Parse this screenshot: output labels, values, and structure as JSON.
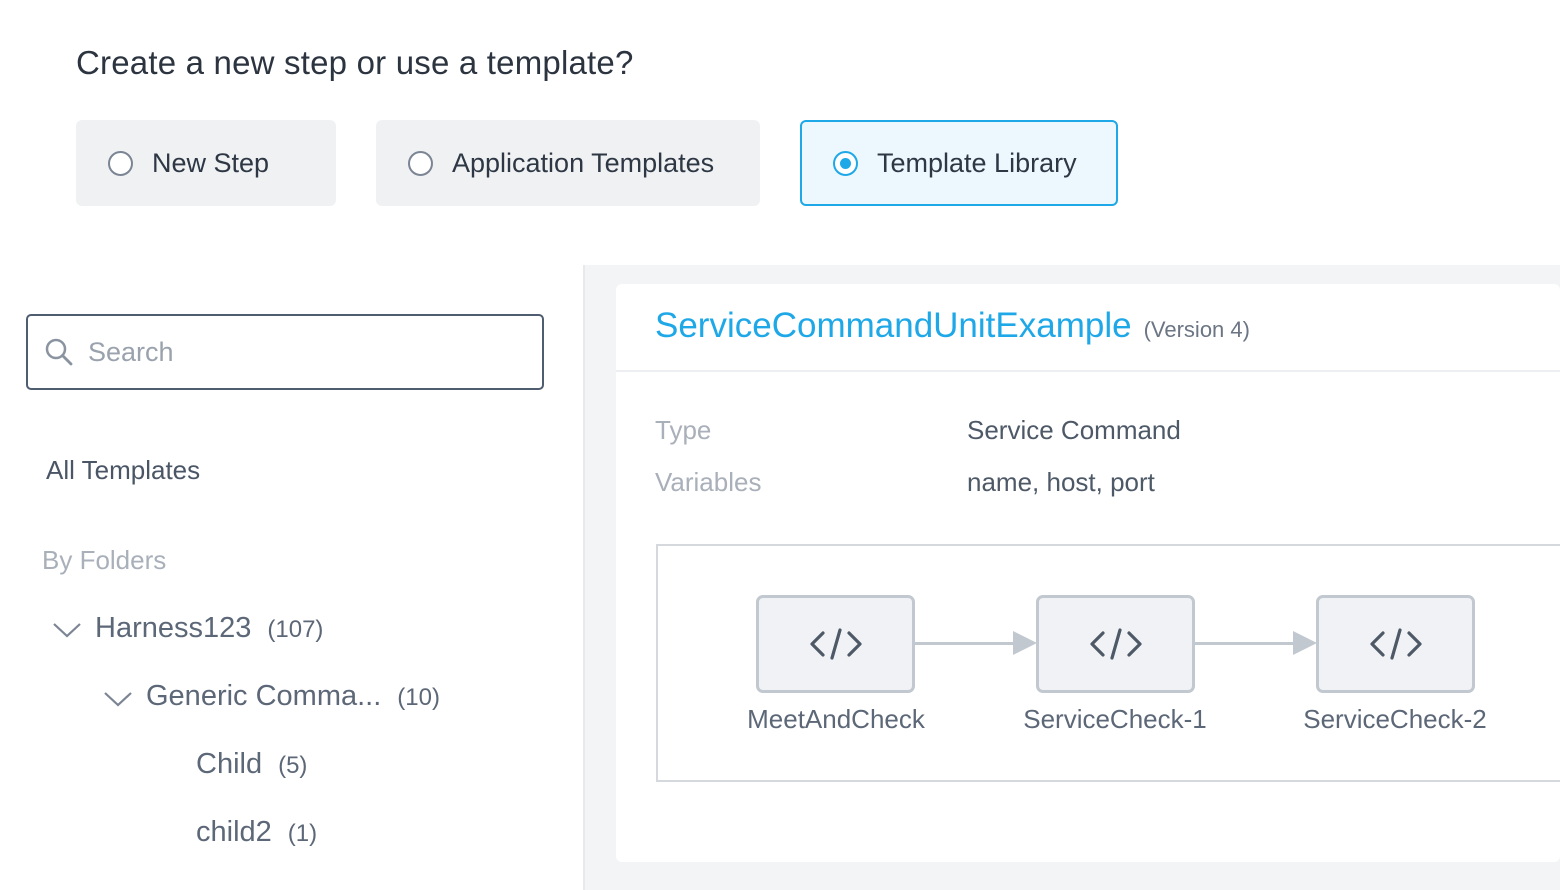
{
  "heading": "Create a new step or use a template?",
  "options": [
    {
      "label": "New Step",
      "selected": false
    },
    {
      "label": "Application Templates",
      "selected": false
    },
    {
      "label": "Template Library",
      "selected": true
    }
  ],
  "sidebar": {
    "search_placeholder": "Search",
    "all_templates": "All Templates",
    "by_folders": "By Folders",
    "folders": [
      {
        "name": "Harness123",
        "count": "(107)"
      },
      {
        "name": "Generic Comma...",
        "count": "(10)"
      },
      {
        "name": "Child",
        "count": "(5)"
      },
      {
        "name": "child2",
        "count": "(1)"
      }
    ]
  },
  "details": {
    "name": "ServiceCommandUnitExample",
    "version": "(Version 4)",
    "type_label": "Type",
    "type_value": "Service Command",
    "variables_label": "Variables",
    "variables_value": "name, host, port",
    "steps": [
      "MeetAndCheck",
      "ServiceCheck-1",
      "ServiceCheck-2"
    ]
  },
  "colors": {
    "accent": "#1fa8e8",
    "node_border": "#c2c8d0"
  },
  "icons": {
    "search": "search-icon",
    "node": "code-icon",
    "expand": "chevron-down-icon"
  }
}
